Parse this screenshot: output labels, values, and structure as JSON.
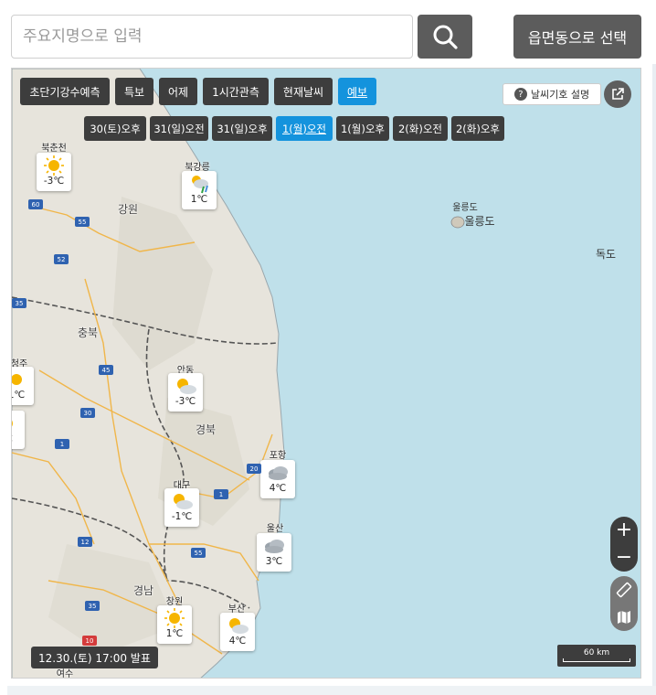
{
  "search": {
    "placeholder": "주요지명으로 입력",
    "region_button": "읍면동으로 선택"
  },
  "map": {
    "tabs": [
      {
        "label": "초단기강수예측",
        "active": false
      },
      {
        "label": "특보",
        "active": false
      },
      {
        "label": "어제",
        "active": false
      },
      {
        "label": "1시간관측",
        "active": false
      },
      {
        "label": "현재날씨",
        "active": false
      },
      {
        "label": "예보",
        "active": true
      }
    ],
    "times": [
      {
        "label": "30(토)오후",
        "active": false
      },
      {
        "label": "31(일)오전",
        "active": false
      },
      {
        "label": "31(일)오후",
        "active": false
      },
      {
        "label": "1(월)오전",
        "active": true
      },
      {
        "label": "1(월)오후",
        "active": false
      },
      {
        "label": "2(화)오전",
        "active": false
      },
      {
        "label": "2(화)오후",
        "active": false
      }
    ],
    "legend_button": "날씨기호 설명",
    "issued": "12.30.(토) 17:00 발표",
    "scale": "60 km",
    "regions": [
      "강원",
      "충북",
      "경북",
      "경남"
    ],
    "islands": {
      "ulleung_small": "울릉도",
      "ulleung_big": "울릉도",
      "dokdo": "독도"
    },
    "stations": [
      {
        "name": "북춘천",
        "temp": "-3℃",
        "icon": "sun"
      },
      {
        "name": "북강릉",
        "temp": "1℃",
        "icon": "rain-snow"
      },
      {
        "name": "안동",
        "temp": "-3℃",
        "icon": "sun-cloud"
      },
      {
        "name": "포항",
        "temp": "4℃",
        "icon": "cloud"
      },
      {
        "name": "대구",
        "temp": "-1℃",
        "icon": "sun-cloud"
      },
      {
        "name": "울산",
        "temp": "3℃",
        "icon": "cloud"
      },
      {
        "name": "창원",
        "temp": "1℃",
        "icon": "sun"
      },
      {
        "name": "부산",
        "temp": "4℃",
        "icon": "sun-cloud"
      },
      {
        "name": "청주",
        "temp": "1℃",
        "icon": "sun"
      },
      {
        "name": "",
        "temp": "℃",
        "icon": "sun"
      }
    ],
    "partial_labels": {
      "cheongju": "청주",
      "yeosu": "여수"
    },
    "routes": [
      "60",
      "55",
      "52",
      "35",
      "45",
      "30",
      "1",
      "20",
      "12",
      "55",
      "35",
      "10"
    ]
  },
  "colors": {
    "sea": "#bfe0ea",
    "land": "#e7e4dc",
    "active_tab": "#1493dd",
    "dark_button": "#3d3d3d"
  }
}
